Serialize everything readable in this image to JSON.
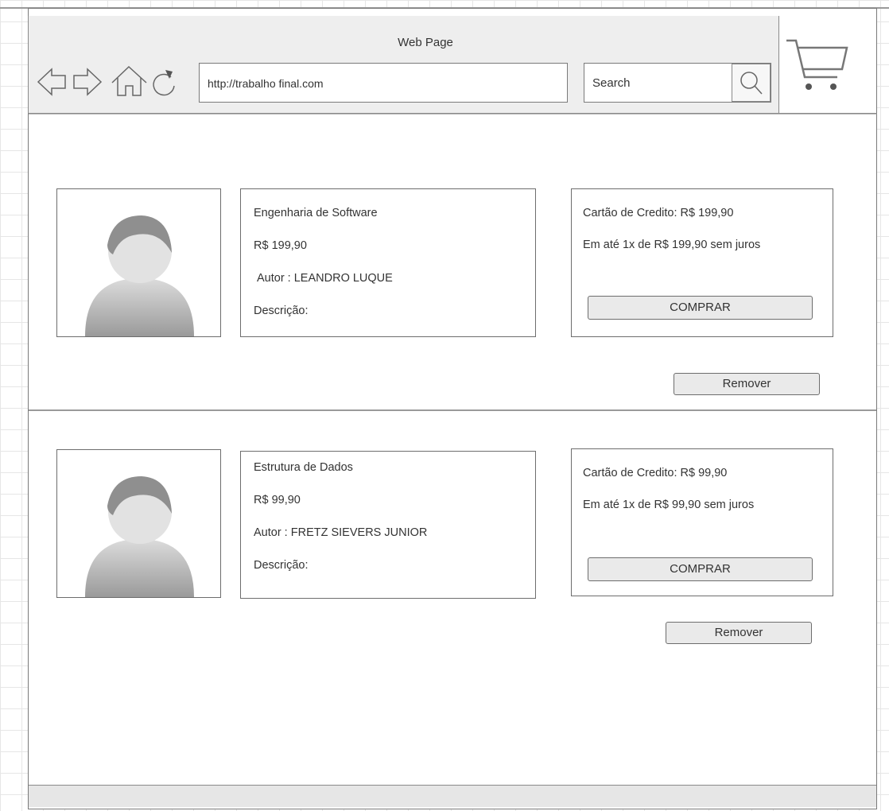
{
  "browser": {
    "title": "Web Page",
    "url": "http://trabalho final.com",
    "search_label": "Search",
    "icons": [
      "back-arrow-icon",
      "forward-arrow-icon",
      "home-icon",
      "refresh-icon",
      "search-icon",
      "cart-icon"
    ]
  },
  "products": [
    {
      "title": "Engenharia de Software",
      "price": "R$ 199,90",
      "author": "Autor : LEANDRO LUQUE",
      "description": "Descrição:",
      "credit": "Cartão de Credito: R$ 199,90",
      "installments": "Em até 1x de R$ 199,90 sem juros",
      "buy_label": "COMPRAR",
      "remove_label": "Remover"
    },
    {
      "title": "Estrutura de Dados",
      "price": "R$ 99,90",
      "author": "Autor : FRETZ SIEVERS JUNIOR",
      "description": "Descrição:",
      "credit": "Cartão de Credito: R$ 99,90",
      "installments": "Em até 1x de R$ 99,90 sem juros",
      "buy_label": "COMPRAR",
      "remove_label": "Remover"
    }
  ]
}
